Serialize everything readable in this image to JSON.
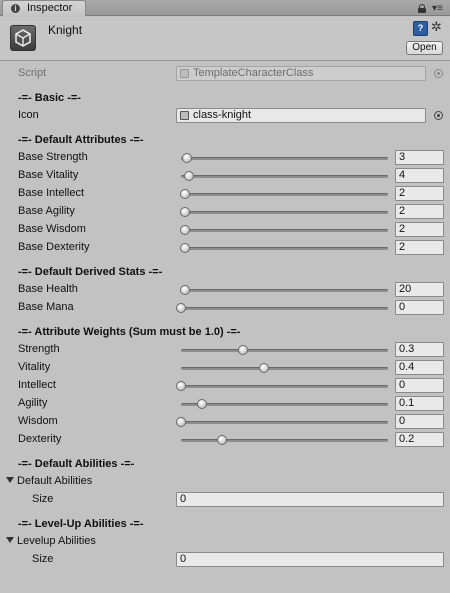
{
  "tab": {
    "title": "Inspector"
  },
  "header": {
    "object_name": "Knight",
    "open_label": "Open"
  },
  "script_row": {
    "label": "Script",
    "value": "TemplateCharacterClass"
  },
  "basic": {
    "title": "-=- Basic -=-",
    "icon_label": "Icon",
    "icon_value": "class-knight"
  },
  "default_attributes": {
    "title": "-=- Default Attributes -=-",
    "slider_range": [
      0,
      100
    ],
    "rows": [
      {
        "label": "Base Strength",
        "value": "3"
      },
      {
        "label": "Base Vitality",
        "value": "4"
      },
      {
        "label": "Base Intellect",
        "value": "2"
      },
      {
        "label": "Base Agility",
        "value": "2"
      },
      {
        "label": "Base Wisdom",
        "value": "2"
      },
      {
        "label": "Base Dexterity",
        "value": "2"
      }
    ]
  },
  "default_derived": {
    "title": "-=- Default Derived Stats -=-",
    "slider_range": [
      0,
      1000
    ],
    "rows": [
      {
        "label": "Base Health",
        "value": "20"
      },
      {
        "label": "Base Mana",
        "value": "0"
      }
    ]
  },
  "attribute_weights": {
    "title": "-=- Attribute Weights (Sum must be 1.0) -=-",
    "slider_range": [
      0,
      1
    ],
    "rows": [
      {
        "label": "Strength",
        "value": "0.3"
      },
      {
        "label": "Vitality",
        "value": "0.4"
      },
      {
        "label": "Intellect",
        "value": "0"
      },
      {
        "label": "Agility",
        "value": "0.1"
      },
      {
        "label": "Wisdom",
        "value": "0"
      },
      {
        "label": "Dexterity",
        "value": "0.2"
      }
    ]
  },
  "default_abilities": {
    "title": "-=- Default Abilities -=-",
    "foldout_label": "Default Abilities",
    "size_label": "Size",
    "size_value": "0"
  },
  "levelup_abilities": {
    "title": "-=- Level-Up Abilities -=-",
    "foldout_label": "Levelup Abilities",
    "size_label": "Size",
    "size_value": "0"
  },
  "icons": {
    "tab": "info-icon",
    "lock": "lock-icon",
    "menu": "menu-icon",
    "object": "unity-object-icon",
    "help": "help-book-icon",
    "gear": "gear-icon"
  }
}
